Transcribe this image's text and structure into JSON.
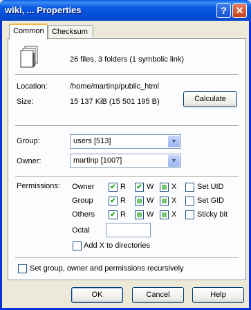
{
  "window": {
    "title": "wiki, ... Properties",
    "help_glyph": "?",
    "close_glyph": "✕"
  },
  "tabs": [
    {
      "label": "Common",
      "active": true
    },
    {
      "label": "Checksum",
      "active": false
    }
  ],
  "summary": {
    "icon": "files-icon",
    "text": "26 files, 3 folders (1 symbolic link)"
  },
  "location": {
    "label": "Location:",
    "value": "/home/martinp/public_html"
  },
  "size": {
    "label": "Size:",
    "value": "15 137 KiB (15 501 195 B)",
    "calculate_label": "Calculate"
  },
  "group": {
    "label": "Group:",
    "value": "users [513]"
  },
  "owner": {
    "label": "Owner:",
    "value": "martinp [1007]"
  },
  "permissions": {
    "label": "Permissions:",
    "rows": [
      {
        "label": "Owner",
        "r": "checked",
        "w": "checked",
        "x": "indeterminate",
        "special_label": "Set UID",
        "special": "unchecked"
      },
      {
        "label": "Group",
        "r": "checked",
        "w": "indeterminate",
        "x": "indeterminate",
        "special_label": "Set GID",
        "special": "unchecked"
      },
      {
        "label": "Others",
        "r": "checked",
        "w": "indeterminate",
        "x": "indeterminate",
        "special_label": "Sticky bit",
        "special": "unchecked"
      }
    ],
    "r_label": "R",
    "w_label": "W",
    "x_label": "X",
    "octal_label": "Octal",
    "octal_value": "",
    "add_x_label": "Add X to directories"
  },
  "recursive_label": "Set group, owner and permissions recursively",
  "buttons": {
    "ok": "OK",
    "cancel": "Cancel",
    "help": "Help"
  },
  "colors": {
    "title_bar": "#0a5ee8",
    "dialog_bg": "#ece9d8",
    "check_green": "#21a121"
  }
}
